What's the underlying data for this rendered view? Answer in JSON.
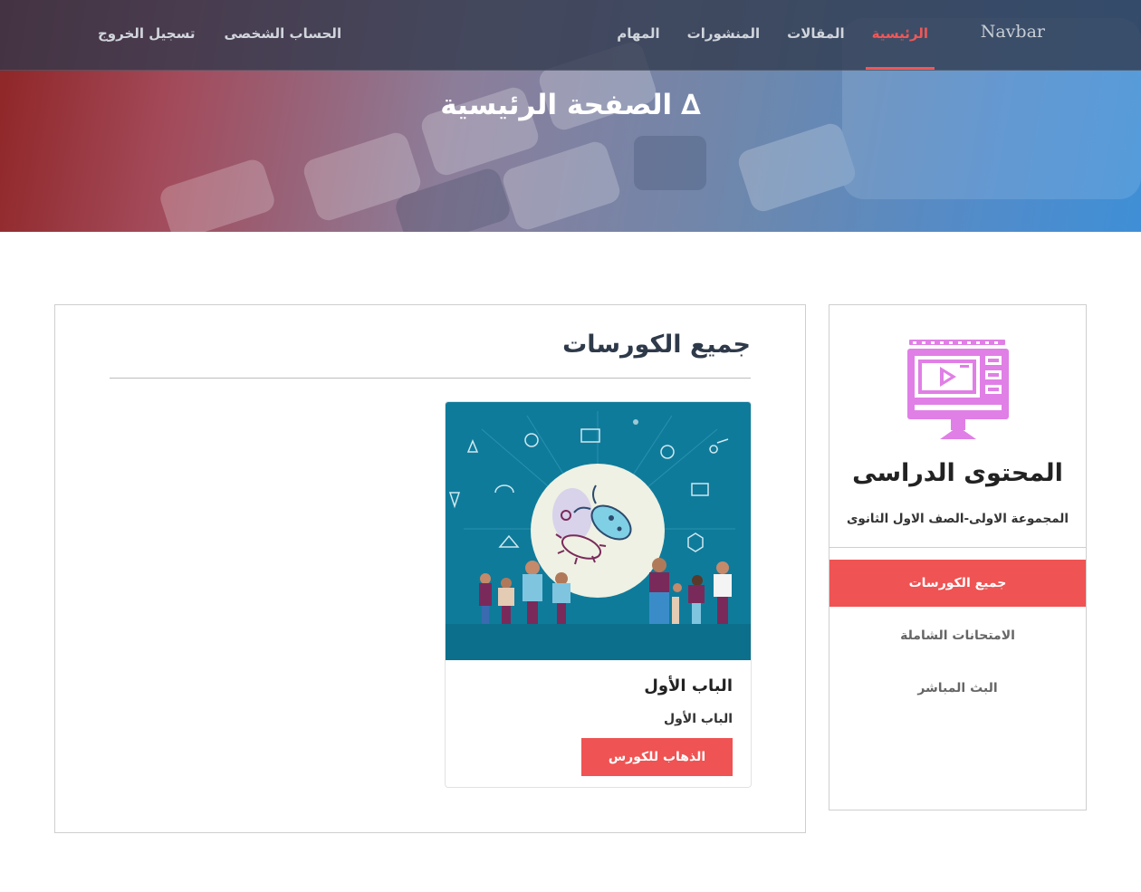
{
  "navbar": {
    "brand": "Navbar",
    "links": [
      {
        "label": "الرئيسية",
        "active": true
      },
      {
        "label": "المقالات",
        "active": false
      },
      {
        "label": "المنشورات",
        "active": false
      },
      {
        "label": "المهام",
        "active": false
      }
    ],
    "account_links": [
      {
        "label": "الحساب الشخصى"
      },
      {
        "label": "تسجيل الخروج"
      }
    ],
    "active_color": "#f05757"
  },
  "hero": {
    "title": "الصفحة الرئيسية",
    "title_icon": "∆"
  },
  "main": {
    "section_title": "جميع الكورسات",
    "courses": [
      {
        "title": "الباب الأول",
        "subtitle": "الباب الأول",
        "button_label": "الذهاب للكورس",
        "image_icon": "bacteria-illustration"
      }
    ]
  },
  "sidebar": {
    "icon": "video-monitor-icon",
    "title": "المحتوى الدراسى",
    "subtitle": "المجموعة الاولى-الصف الاول الثانوى",
    "menu": [
      {
        "label": "جميع الكورسات",
        "active": true
      },
      {
        "label": "الامتحانات الشاملة",
        "active": false
      },
      {
        "label": "البث المباشر",
        "active": false
      }
    ]
  },
  "colors": {
    "accent": "#ef5353",
    "icon_color": "#e07fe6",
    "illustration_bg": "#0f7b9b"
  }
}
